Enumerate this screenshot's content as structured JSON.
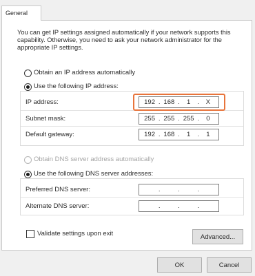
{
  "tab": {
    "label": "General"
  },
  "description": "You can get IP settings assigned automatically if your network supports this capability. Otherwise, you need to ask your network administrator for the appropriate IP settings.",
  "ip_options": {
    "auto": {
      "label": "Obtain an IP address automatically",
      "selected": false
    },
    "manual": {
      "label": "Use the following IP address:",
      "selected": true
    }
  },
  "ip_fields": [
    {
      "label": "IP address:",
      "octets": [
        "192",
        "168",
        "1",
        "X"
      ],
      "highlighted": true
    },
    {
      "label": "Subnet mask:",
      "octets": [
        "255",
        "255",
        "255",
        "0"
      ]
    },
    {
      "label": "Default gateway:",
      "octets": [
        "192",
        "168",
        "1",
        "1"
      ]
    }
  ],
  "dns_options": {
    "auto": {
      "label": "Obtain DNS server address automatically",
      "selected": false,
      "disabled": true
    },
    "manual": {
      "label": "Use the following DNS server addresses:",
      "selected": true
    }
  },
  "dns_fields": [
    {
      "label": "Preferred DNS server:",
      "octets": [
        "",
        "",
        "",
        ""
      ]
    },
    {
      "label": "Alternate DNS server:",
      "octets": [
        "",
        "",
        "",
        ""
      ]
    }
  ],
  "validate": {
    "label": "Validate settings upon exit",
    "checked": false
  },
  "buttons": {
    "advanced": "Advanced...",
    "ok": "OK",
    "cancel": "Cancel"
  },
  "colors": {
    "highlight": "#e8743b"
  }
}
